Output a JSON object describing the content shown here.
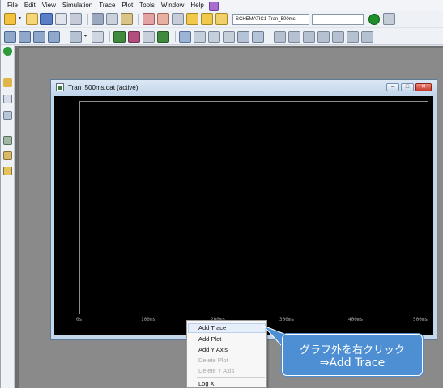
{
  "menubar": {
    "items": [
      "File",
      "Edit",
      "View",
      "Simulation",
      "Trace",
      "Plot",
      "Tools",
      "Window",
      "Help"
    ]
  },
  "toolbar": {
    "schematic_combo_value": "SCHEMATIC1-Tran_500ms"
  },
  "plot_window": {
    "title": "Tran_500ms.dat (active)",
    "x_ticks": [
      "0s",
      "100ms",
      "200ms",
      "300ms",
      "400ms",
      "500ms"
    ]
  },
  "context_menu": {
    "items": [
      {
        "label": "Add Trace",
        "enabled": true,
        "highlighted": true
      },
      {
        "label": "Add Plot",
        "enabled": true
      },
      {
        "label": "Add Y Axis",
        "enabled": true
      },
      {
        "label": "Delete Plot",
        "enabled": false
      },
      {
        "label": "Delete Y Axis",
        "enabled": false
      },
      {
        "label": "Log X",
        "enabled": true
      }
    ]
  },
  "callout": {
    "line1": "グラフ外を右クリック",
    "line2": "⇒Add Trace"
  },
  "colors": {
    "callout_fill": "#4e8fd3",
    "plot_background": "#000000",
    "run_button": "#1f8f2c"
  }
}
